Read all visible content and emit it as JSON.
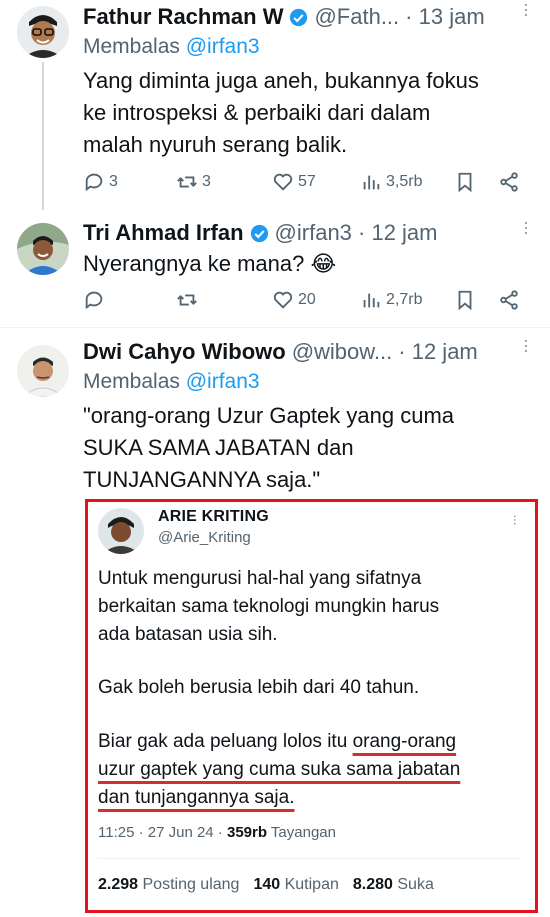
{
  "tweets": [
    {
      "name": "Fathur Rachman W",
      "handle": "@Fath...",
      "time": "· 13 jam",
      "reply_prefix": "Membalas",
      "reply_to": "@irfan3",
      "lines": [
        "Yang diminta juga aneh, bukannya fokus",
        "ke introspeksi & perbaiki dari dalam",
        "malah nyuruh serang balik."
      ],
      "replies": "3",
      "retweets": "3",
      "likes": "57",
      "views": "3,5rb"
    },
    {
      "name": "Tri Ahmad Irfan",
      "handle": "@irfan3 · 12 jam",
      "text": "Nyerangnya ke mana? 😂",
      "likes": "20",
      "views": "2,7rb"
    },
    {
      "name": "Dwi Cahyo Wibowo",
      "handle": "@wibow...",
      "time": "· 12 jam",
      "reply_prefix": "Membalas",
      "reply_to": "@irfan3",
      "lines": [
        "\"orang-orang Uzur Gaptek yang cuma",
        "SUKA SAMA JABATAN dan",
        "TUNJANGANNYA saja.\""
      ]
    }
  ],
  "quoted": {
    "name": "ARIE KRITING",
    "handle": "@Arie_Kriting",
    "p1": [
      "Untuk mengurusi hal-hal yang sifatnya",
      "berkaitan sama teknologi mungkin harus",
      "ada batasan usia sih."
    ],
    "p2": "Gak boleh berusia lebih dari 40 tahun.",
    "p3_start": "Biar gak ada peluang lolos itu ",
    "p3_u1": "orang-orang",
    "p3_u2": "uzur gaptek yang cuma suka sama jabatan",
    "p3_u3": "dan tunjangannya saja.",
    "time": "11:25 · 27 Jun 24 · ",
    "views_count": "359rb",
    "views_label": " Tayangan",
    "reposts_count": "2.298",
    "reposts_label": " Posting ulang",
    "quotes_count": "140",
    "quotes_label": " Kutipan",
    "likes_count": "8.280",
    "likes_label": " Suka"
  },
  "colors": {
    "accent": "#1d9bf0",
    "highlight_border": "#e3131b",
    "underline": "#d32f2f"
  }
}
